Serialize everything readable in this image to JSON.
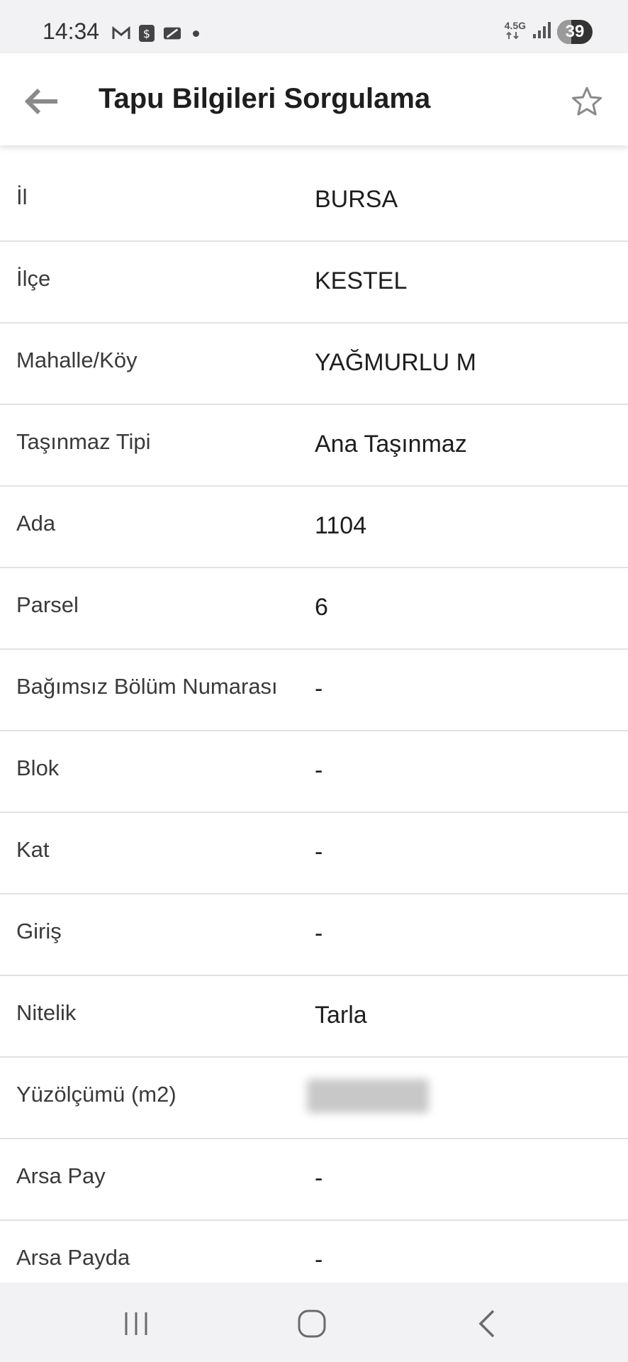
{
  "status_bar": {
    "time": "14:34",
    "network": "4.5G",
    "battery": "39",
    "battery_level": 0.39,
    "left_icons": [
      "gmail-icon",
      "dollar-app-icon",
      "card-app-icon"
    ],
    "right_icons": [
      "network-arrows-icon",
      "signal-icon",
      "battery-icon"
    ]
  },
  "app_bar": {
    "title": "Tapu Bilgileri Sorgulama",
    "back_icon": "arrow-left-icon",
    "favorite_icon": "star-outline-icon"
  },
  "fields": [
    {
      "label": "İl",
      "value": "BURSA"
    },
    {
      "label": "İlçe",
      "value": "KESTEL"
    },
    {
      "label": "Mahalle/Köy",
      "value": "YAĞMURLU M"
    },
    {
      "label": "Taşınmaz Tipi",
      "value": "Ana Taşınmaz"
    },
    {
      "label": "Ada",
      "value": "1104"
    },
    {
      "label": "Parsel",
      "value": "6"
    },
    {
      "label": "Bağımsız Bölüm Numarası",
      "value": "-"
    },
    {
      "label": "Blok",
      "value": "-"
    },
    {
      "label": "Kat",
      "value": "-"
    },
    {
      "label": "Giriş",
      "value": "-"
    },
    {
      "label": "Nitelik",
      "value": "Tarla"
    },
    {
      "label": "Yüzölçümü (m2)",
      "value": ""
    },
    {
      "label": "Arsa Pay",
      "value": "-"
    },
    {
      "label": "Arsa Payda",
      "value": "-"
    }
  ],
  "nav_bar": {
    "recents_icon": "recent-apps-icon",
    "home_icon": "home-icon",
    "back_icon": "back-chevron-icon"
  },
  "colors": {
    "status_bg": "#f2f2f4",
    "title_text": "#1e1e1e",
    "label_text": "#3a3a3a",
    "divider": "#e2e2e2"
  }
}
